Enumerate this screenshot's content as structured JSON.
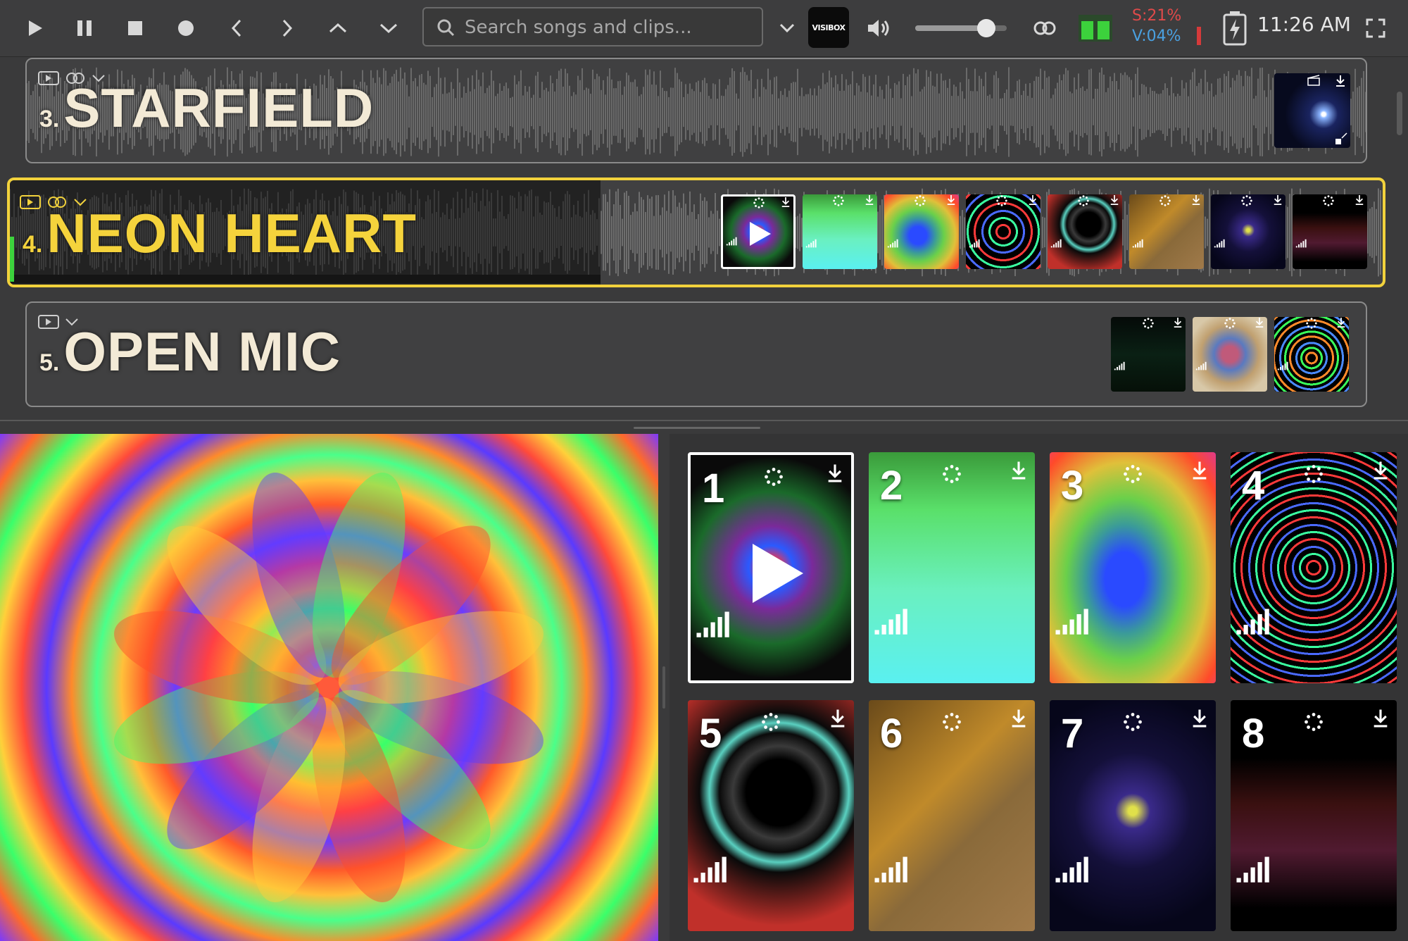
{
  "toolbar": {
    "search_placeholder": "Search songs and clips...",
    "logo_text": "VISIBOX",
    "volume_level": 0.78,
    "stat_s": "S:21%",
    "stat_v": "V:04%",
    "time": "11:26 AM",
    "icons": [
      "play-icon",
      "pause-icon",
      "stop-icon",
      "record-icon",
      "previous-icon",
      "next-icon",
      "up-icon",
      "down-icon",
      "search-icon",
      "dropdown-chevron-icon",
      "speaker-icon",
      "link-icon",
      "split-screen-icon",
      "battery-charging-icon",
      "fullscreen-icon"
    ]
  },
  "songs": [
    {
      "num": "3.",
      "title": "STARFIELD",
      "active": false,
      "clip_count": 1
    },
    {
      "num": "4.",
      "title": "NEON HEART",
      "active": true,
      "clip_count": 8,
      "progress": 0.42
    },
    {
      "num": "5.",
      "title": "OPEN MIC",
      "active": false,
      "clip_count": 3
    }
  ],
  "clips": [
    {
      "num": "1",
      "selected": true
    },
    {
      "num": "2",
      "selected": false
    },
    {
      "num": "3",
      "selected": false
    },
    {
      "num": "4",
      "selected": false
    },
    {
      "num": "5",
      "selected": false
    },
    {
      "num": "6",
      "selected": false
    },
    {
      "num": "7",
      "selected": false
    },
    {
      "num": "8",
      "selected": false
    }
  ],
  "colors": {
    "accent": "#f2d23c",
    "stat_s": "#e04a4a",
    "stat_v": "#4aa0e0",
    "progress_green": "#3cd23c"
  }
}
